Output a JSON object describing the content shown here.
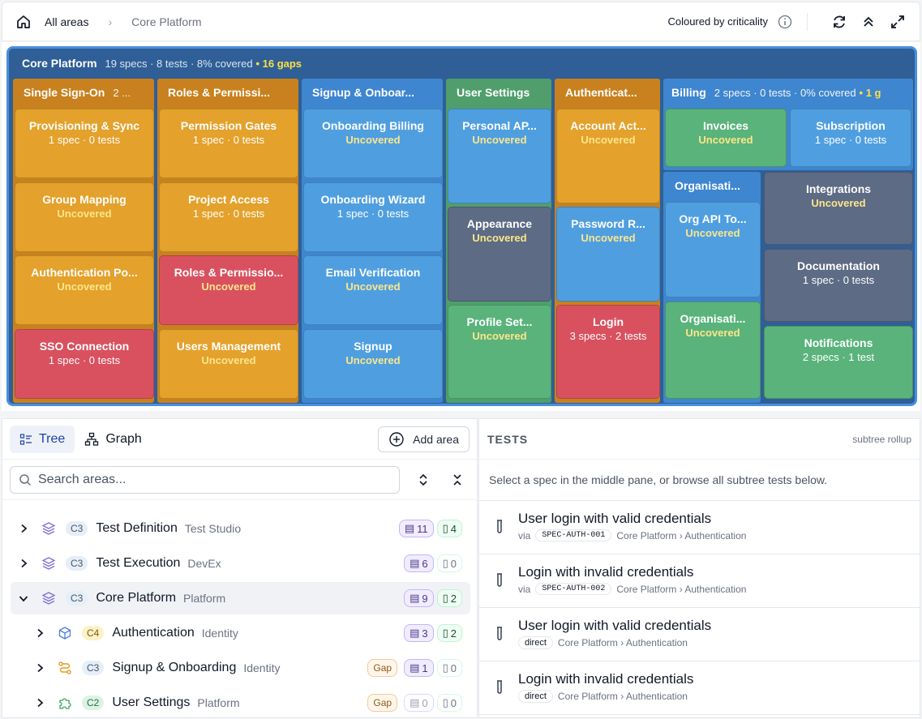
{
  "breadcrumb": {
    "root": "All areas",
    "current": "Core Platform"
  },
  "toolbar": {
    "colour_mode": "Coloured by criticality"
  },
  "map": {
    "title": "Core Platform",
    "meta": "19 specs · 8 tests · 8% covered",
    "gaps": "• 16 gaps",
    "groups": {
      "sso": {
        "title": "Single Sign-On",
        "meta": "2 ..."
      },
      "roles": {
        "title": "Roles & Permissi..."
      },
      "signup": {
        "title": "Signup & Onboar..."
      },
      "settings": {
        "title": "User Settings"
      },
      "auth": {
        "title": "Authenticat..."
      },
      "billing": {
        "title": "Billing",
        "meta": "2 specs · 0 tests · 0% covered",
        "gaps": "• 1 g"
      },
      "org": {
        "title": "Organisati..."
      }
    },
    "tiles": {
      "provisioning": {
        "name": "Provisioning & Sync",
        "status": "1 spec · 0 tests"
      },
      "group_mapping": {
        "name": "Group Mapping",
        "status": "Uncovered"
      },
      "auth_policy": {
        "name": "Authentication Po...",
        "status": "Uncovered"
      },
      "sso_connection": {
        "name": "SSO Connection",
        "status": "1 spec · 0 tests"
      },
      "permission_gates": {
        "name": "Permission Gates",
        "status": "1 spec · 0 tests"
      },
      "project_access": {
        "name": "Project Access",
        "status": "1 spec · 0 tests"
      },
      "roles_perms": {
        "name": "Roles & Permissio...",
        "status": "Uncovered"
      },
      "users_mgmt": {
        "name": "Users Management",
        "status": "Uncovered"
      },
      "onb_billing": {
        "name": "Onboarding Billing",
        "status": "Uncovered"
      },
      "onb_wizard": {
        "name": "Onboarding Wizard",
        "status": "1 spec · 0 tests"
      },
      "email_verif": {
        "name": "Email Verification",
        "status": "Uncovered"
      },
      "signup": {
        "name": "Signup",
        "status": "Uncovered"
      },
      "personal_api": {
        "name": "Personal AP...",
        "status": "Uncovered"
      },
      "appearance": {
        "name": "Appearance",
        "status": "Uncovered"
      },
      "profile_set": {
        "name": "Profile Set...",
        "status": "Uncovered"
      },
      "account_act": {
        "name": "Account Act...",
        "status": "Uncovered"
      },
      "password_r": {
        "name": "Password R...",
        "status": "Uncovered"
      },
      "login": {
        "name": "Login",
        "status": "3 specs · 2 tests"
      },
      "invoices": {
        "name": "Invoices",
        "status": "Uncovered"
      },
      "subscription": {
        "name": "Subscription",
        "status": "1 spec · 0 tests"
      },
      "org_api": {
        "name": "Org API To...",
        "status": "Uncovered"
      },
      "org_other": {
        "name": "Organisati...",
        "status": "Uncovered"
      },
      "integrations": {
        "name": "Integrations",
        "status": "Uncovered"
      },
      "documentation": {
        "name": "Documentation",
        "status": "1 spec · 0 tests"
      },
      "notifications": {
        "name": "Notifications",
        "status": "2 specs · 1 test"
      }
    }
  },
  "left": {
    "tab_tree": "Tree",
    "tab_graph": "Graph",
    "add_area": "Add area",
    "search_placeholder": "Search areas...",
    "rows": [
      {
        "crit": "C3",
        "name": "Test Definition",
        "owner": "Test Studio",
        "specs": "11",
        "tests": "4"
      },
      {
        "crit": "C3",
        "name": "Test Execution",
        "owner": "DevEx",
        "specs": "6",
        "tests": "0"
      },
      {
        "crit": "C3",
        "name": "Core Platform",
        "owner": "Platform",
        "specs": "9",
        "tests": "2"
      },
      {
        "crit": "C4",
        "name": "Authentication",
        "owner": "Identity",
        "specs": "3",
        "tests": "2"
      },
      {
        "crit": "C3",
        "name": "Signup & Onboarding",
        "owner": "Identity",
        "gap": "Gap",
        "specs": "1",
        "tests": "0"
      },
      {
        "crit": "C2",
        "name": "User Settings",
        "owner": "Platform",
        "gap": "Gap",
        "specs": "0",
        "tests": "0"
      }
    ]
  },
  "right": {
    "header": "TESTS",
    "rollup": "subtree rollup",
    "hint": "Select a spec in the middle pane, or browse all subtree tests below.",
    "tests": [
      {
        "title": "User login with valid credentials",
        "via": "via",
        "spec": "SPEC-AUTH-001",
        "path": "Core Platform › Authentication"
      },
      {
        "title": "Login with invalid credentials",
        "via": "via",
        "spec": "SPEC-AUTH-002",
        "path": "Core Platform › Authentication"
      },
      {
        "title": "User login with valid credentials",
        "tag": "direct",
        "path": "Core Platform › Authentication"
      },
      {
        "title": "Login with invalid credentials",
        "tag": "direct",
        "path": "Core Platform › Authentication"
      }
    ]
  }
}
